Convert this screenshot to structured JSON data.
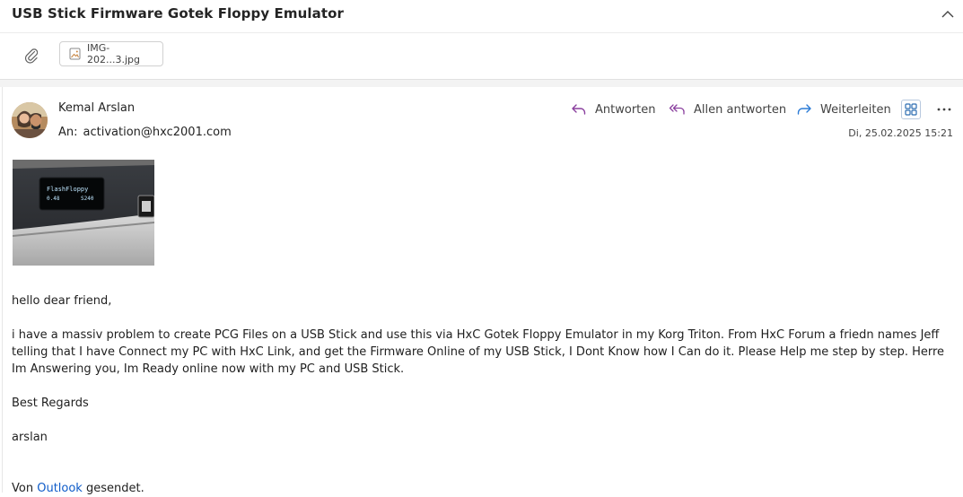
{
  "header": {
    "subject": "USB Stick Firmware Gotek Floppy Emulator",
    "collapse_icon": "chevron-up-icon"
  },
  "attachments": {
    "paperclip_icon": "paperclip-icon",
    "items": [
      {
        "name": "IMG-202...3.jpg",
        "icon": "image-file-icon"
      }
    ]
  },
  "message": {
    "sender_name": "Kemal Arslan",
    "to_label": "An:",
    "to_address": "activation@hxc2001.com",
    "date": "Di, 25.02.2025 15:21",
    "actions": {
      "reply": "Antworten",
      "reply_all": "Allen antworten",
      "forward": "Weiterleiten"
    },
    "inline_image_text": {
      "line1": "FlashFloppy",
      "line2_left": "0.48",
      "line2_right": "S240"
    },
    "body": {
      "greeting": "hello dear friend,",
      "paragraph": "i have a massiv problem to create PCG Files on a USB Stick and use this via HxC Gotek Floppy Emulator in my Korg Triton. From HxC Forum a friedn names Jeff telling that I have Connect my PC with HxC Link, and get the Firmware Online of my USB Stick, I Dont Know how I Can do it. Please Help me step by step. Herre Im Answering you, Im Ready online now with my PC and USB Stick.",
      "closing": "Best Regards",
      "signature": "arslan",
      "sent_prefix": "Von ",
      "sent_link": "Outlook",
      "sent_suffix": " gesendet."
    }
  },
  "colors": {
    "reply_icon": "#8a3f9e",
    "forward_icon": "#2b7bd6",
    "link": "#0f5cc9"
  }
}
